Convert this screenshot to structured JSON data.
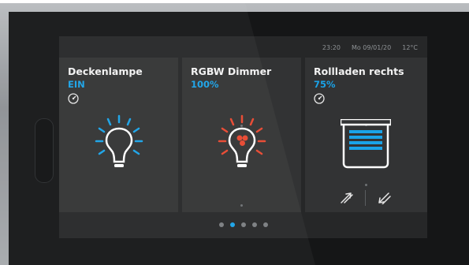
{
  "status": {
    "time": "23:20",
    "date": "Mo 09/01/20",
    "temperature": "12°C"
  },
  "tiles": [
    {
      "title": "Deckenlampe",
      "value": "EIN"
    },
    {
      "title": "RGBW Dimmer",
      "value": "100%"
    },
    {
      "title": "Rollladen rechts",
      "value": "75%"
    }
  ],
  "pager": {
    "count": 5,
    "active_index": 1
  },
  "colors": {
    "accent": "#1aa3e8",
    "lamp_on": "#1aa3e8",
    "dimmer_red": "#e8472f",
    "tile_bg": "#323334",
    "screen_bg": "#262728"
  },
  "icons": {
    "deckenlampe": "lightbulb-icon",
    "rgbw": "rgb-lightbulb-icon",
    "rollladen": "blind-icon",
    "gauge": "dial-icon",
    "up": "arrow-up-icon",
    "down": "arrow-down-icon"
  }
}
